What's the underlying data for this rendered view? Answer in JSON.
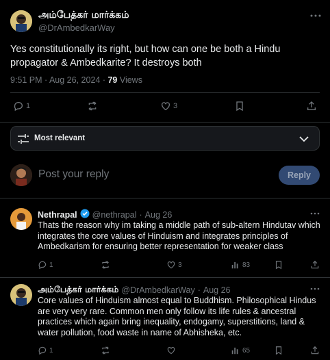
{
  "main_tweet": {
    "author_name": "அம்பேத்கர் மார்க்கம்",
    "author_handle": "@DrAmbedkarWay",
    "text": "Yes constitutionally its right, but how can one be both a Hindu propagator & Ambedkarite? It destroys both",
    "time": "9:51 PM · Aug 26, 2024 · ",
    "views_count": "79",
    "views_label": " Views",
    "reply_count": "1",
    "like_count": "3"
  },
  "filter": {
    "label": "Most relevant"
  },
  "composer": {
    "placeholder": "Post your reply",
    "button_label": "Reply"
  },
  "replies": [
    {
      "name": "Nethrapal",
      "handle": "@nethrapal",
      "sep": "·",
      "date": "Aug 26",
      "text": "Thats the reason why im taking a middle path of sub-altern Hindutav which integrates the core values of Hinduism and integrates principles of Ambedkarism for ensuring better representation for weaker class",
      "reply_count": "1",
      "like_count": "3",
      "views": "83"
    },
    {
      "name": "அம்பேத்கர் மார்க்கம்",
      "handle": "@DrAmbedkarWay",
      "sep": "·",
      "date": "Aug 26",
      "text": "Core values of Hinduism almost equal to Buddhism. Philosophical Hindus are very very rare. Common men only follow its life rules & ancestral practices which again bring inequality, endogamy, superstitions, land & water pollution, food waste in name of Abhisheka, etc.",
      "reply_count": "1",
      "like_count": "",
      "views": "65"
    }
  ]
}
